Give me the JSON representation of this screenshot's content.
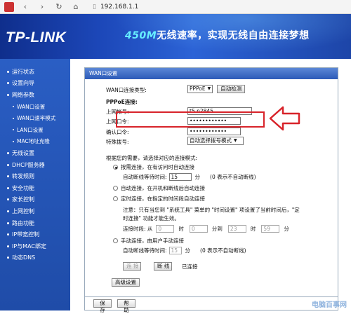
{
  "browser": {
    "url": "192.168.1.1"
  },
  "header": {
    "logo": "TP-LINK",
    "slogan_num": "450M",
    "slogan_text": "无线速率，实现无线自由连接梦想"
  },
  "sidebar": {
    "items": [
      {
        "label": "运行状态"
      },
      {
        "label": "设置向导"
      },
      {
        "label": "网络参数"
      },
      {
        "label": "WAN口设置"
      },
      {
        "label": "WAN口速率模式"
      },
      {
        "label": "LAN口设置"
      },
      {
        "label": "MAC地址克隆"
      },
      {
        "label": "无线设置"
      },
      {
        "label": "DHCP服务器"
      },
      {
        "label": "转发规则"
      },
      {
        "label": "安全功能"
      },
      {
        "label": "家长控制"
      },
      {
        "label": "上网控制"
      },
      {
        "label": "路由功能"
      },
      {
        "label": "IP带宽控制"
      },
      {
        "label": "IP与MAC绑定"
      },
      {
        "label": "动态DNS"
      }
    ]
  },
  "panel": {
    "title": "WAN口设置",
    "wan_type_label": "WAN口连接类型:",
    "wan_type_value": "PPPoE",
    "auto_detect": "自动检测",
    "pppoe_section": "PPPoE连接:",
    "account_label": "上网帐号:",
    "account_value": "t5      n2845",
    "password_label": "上网口令:",
    "password_value": "••••••••••••",
    "confirm_label": "确认口令:",
    "confirm_value": "••••••••••••",
    "dial_label": "特殊拨号:",
    "dial_value": "自动选择拨号模式",
    "mode_intro": "根据您的需要，请选择对应的连接模式:",
    "mode_on_demand": "按需连接，在有访问时自动连接",
    "idle_label_1": "自动断线等待时间:",
    "idle_value_1": "15",
    "idle_unit_1": "分",
    "idle_hint_1": "(0 表示不自动断线)",
    "mode_auto": "自动连接，在开机和断线后自动连接",
    "mode_timed": "定时连接，在指定的时间段自动连接",
    "timed_note_1": "注意：只有当您到 \"系统工具\" 菜单的 \"时间设置\" 项设置了当前时间后，\"定",
    "timed_note_2": "时连接\" 功能才能生效。",
    "period_label": "连接时段: 从",
    "t_from_h": "0",
    "t_hour_1": "时",
    "t_from_m": "0",
    "t_min_1": "分到",
    "t_to_h": "23",
    "t_hour_2": "时",
    "t_to_m": "59",
    "t_min_2": "分",
    "mode_manual": "手动连接，由用户手动连接",
    "idle_label_2": "自动断线等待时间:",
    "idle_value_2": "15",
    "idle_unit_2": "分",
    "idle_hint_2": "(0 表示不自动断线)",
    "connect_btn": "连 接",
    "disconnect_btn": "断 线",
    "status": "已连接",
    "advanced_btn": "高级设置"
  },
  "footer": {
    "save": "保 存",
    "help": "帮 助"
  },
  "watermark": "电脑百事网"
}
